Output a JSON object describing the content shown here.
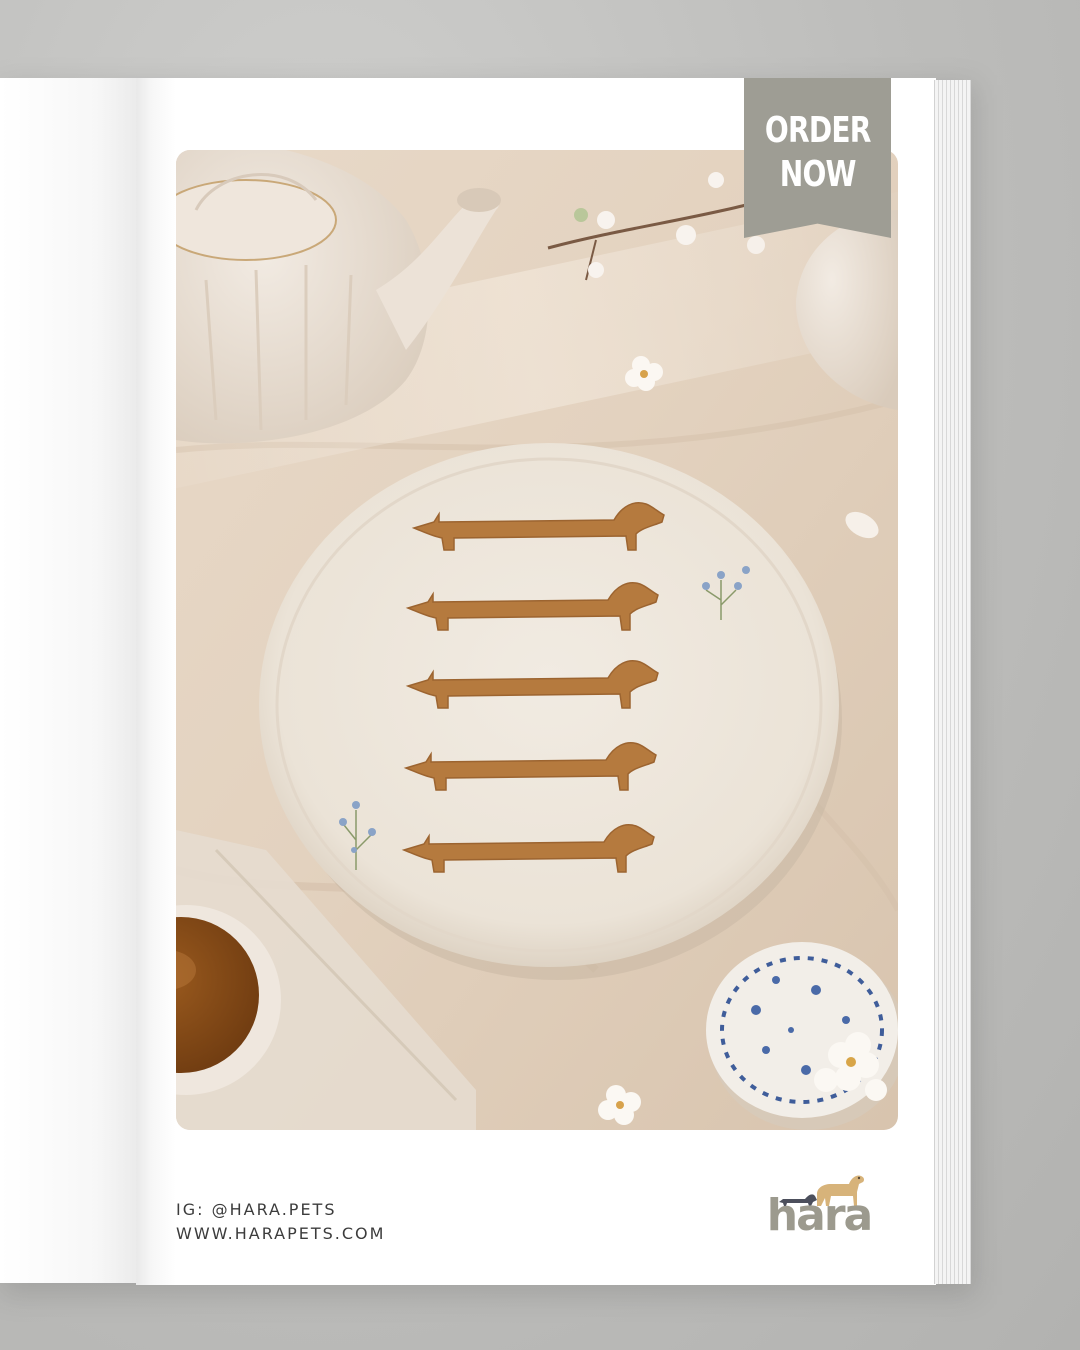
{
  "ad": {
    "cta_line1": "ORDER",
    "cta_line2": "NOW",
    "instagram": "IG: @HARA.PETS",
    "website": "WWW.HARAPETS.COM",
    "brand": "hara"
  },
  "colors": {
    "ribbon": "#9e9d94",
    "brand_text": "#9c9a8e",
    "footer_text": "#3c3c3c",
    "biscuit": "#b57a3e"
  },
  "icons": {
    "logo_mark": "dachshund-and-golden-dog-icon"
  }
}
